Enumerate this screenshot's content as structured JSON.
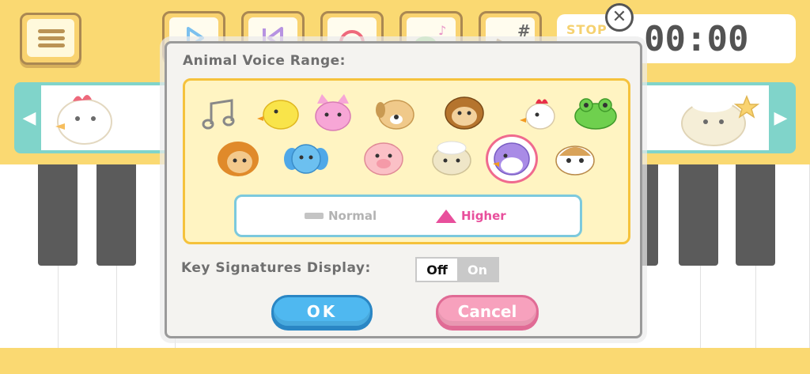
{
  "app": {
    "timer": "00:00",
    "stop_label": "STOP",
    "toolbar_icons": [
      "menu-icon",
      "play-icon",
      "rewind-icon",
      "record-icon",
      "frog-note-icon",
      "key-signature-icon"
    ]
  },
  "dialog": {
    "heading": "Animal Voice Range:",
    "animals": [
      "music-note",
      "chick",
      "cat",
      "dog",
      "monkey",
      "chicken",
      "frog",
      "lion",
      "elephant",
      "pig",
      "sheep",
      "penguin",
      "hamster"
    ],
    "selected_animal": "penguin",
    "range": {
      "normal_label": "Normal",
      "higher_label": "Higher",
      "selected": "Higher"
    },
    "key_signatures_label": "Key Signatures Display:",
    "toggle": {
      "off_label": "Off",
      "on_label": "On",
      "selected": "Off"
    },
    "ok_label": "OK",
    "cancel_label": "Cancel"
  },
  "colors": {
    "accent_yellow": "#f8cb3c",
    "teal": "#4fc4b6",
    "ok_blue": "#4fb8f0",
    "cancel_pink": "#f7a1bd",
    "higher_pink": "#e84f9c"
  }
}
